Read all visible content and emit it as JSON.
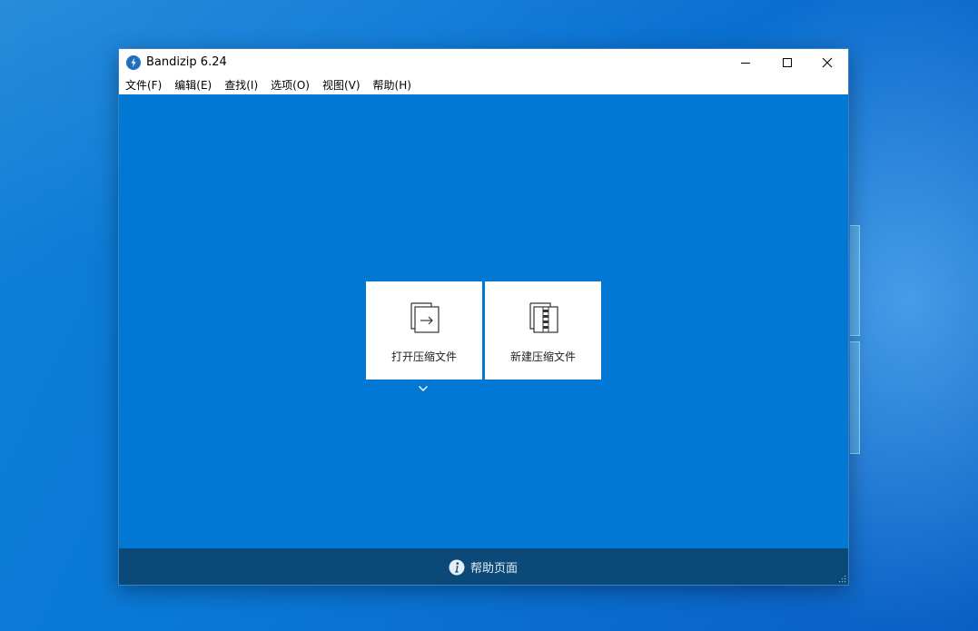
{
  "window": {
    "title": "Bandizip 6.24",
    "accent": "#0078d4",
    "footer_color": "#0b4a78"
  },
  "controls": {
    "minimize": "minimize-icon",
    "maximize": "maximize-icon",
    "close": "close-icon"
  },
  "menu": {
    "items": [
      {
        "label": "文件(F)"
      },
      {
        "label": "编辑(E)"
      },
      {
        "label": "查找(I)"
      },
      {
        "label": "选项(O)"
      },
      {
        "label": "视图(V)"
      },
      {
        "label": "帮助(H)"
      }
    ]
  },
  "tiles": {
    "open_label": "打开压缩文件",
    "open_icon": "open-archive-icon",
    "new_label": "新建压缩文件",
    "new_icon": "new-archive-icon"
  },
  "footer": {
    "help_label": "帮助页面",
    "help_icon": "info-icon"
  }
}
